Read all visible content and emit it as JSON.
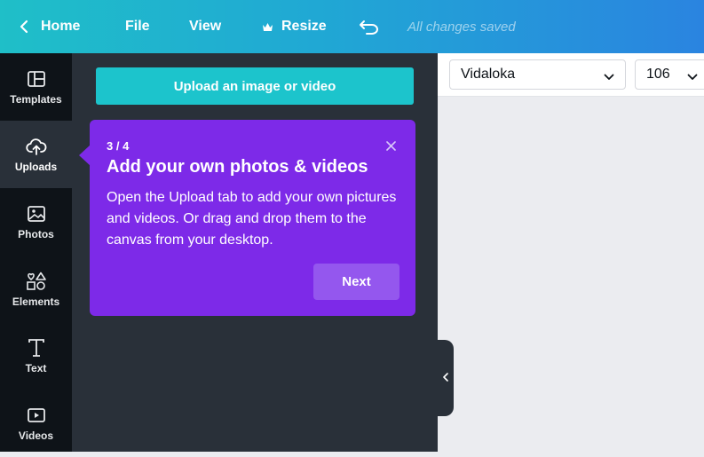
{
  "topbar": {
    "home_label": "Home",
    "file_label": "File",
    "view_label": "View",
    "resize_label": "Resize",
    "save_status": "All changes saved"
  },
  "rail": {
    "items": [
      {
        "label": "Templates",
        "icon": "templates-icon"
      },
      {
        "label": "Uploads",
        "icon": "upload-cloud-icon",
        "active": true
      },
      {
        "label": "Photos",
        "icon": "photos-icon"
      },
      {
        "label": "Elements",
        "icon": "elements-icon"
      },
      {
        "label": "Text",
        "icon": "text-icon"
      },
      {
        "label": "Videos",
        "icon": "videos-icon"
      }
    ]
  },
  "panel": {
    "upload_button_label": "Upload an image or video"
  },
  "tooltip": {
    "step": "3 / 4",
    "title": "Add your own photos & videos",
    "body": "Open the Upload tab to add your own pictures and videos. Or drag and drop them to the canvas from your desktop.",
    "next_label": "Next"
  },
  "editor": {
    "font_name": "Vidaloka",
    "font_size": "106"
  },
  "colors": {
    "accent_teal": "#1cc4cc",
    "tooltip_purple": "#7d2ae8",
    "rail_bg": "#0e1318",
    "panel_bg": "#293039"
  }
}
